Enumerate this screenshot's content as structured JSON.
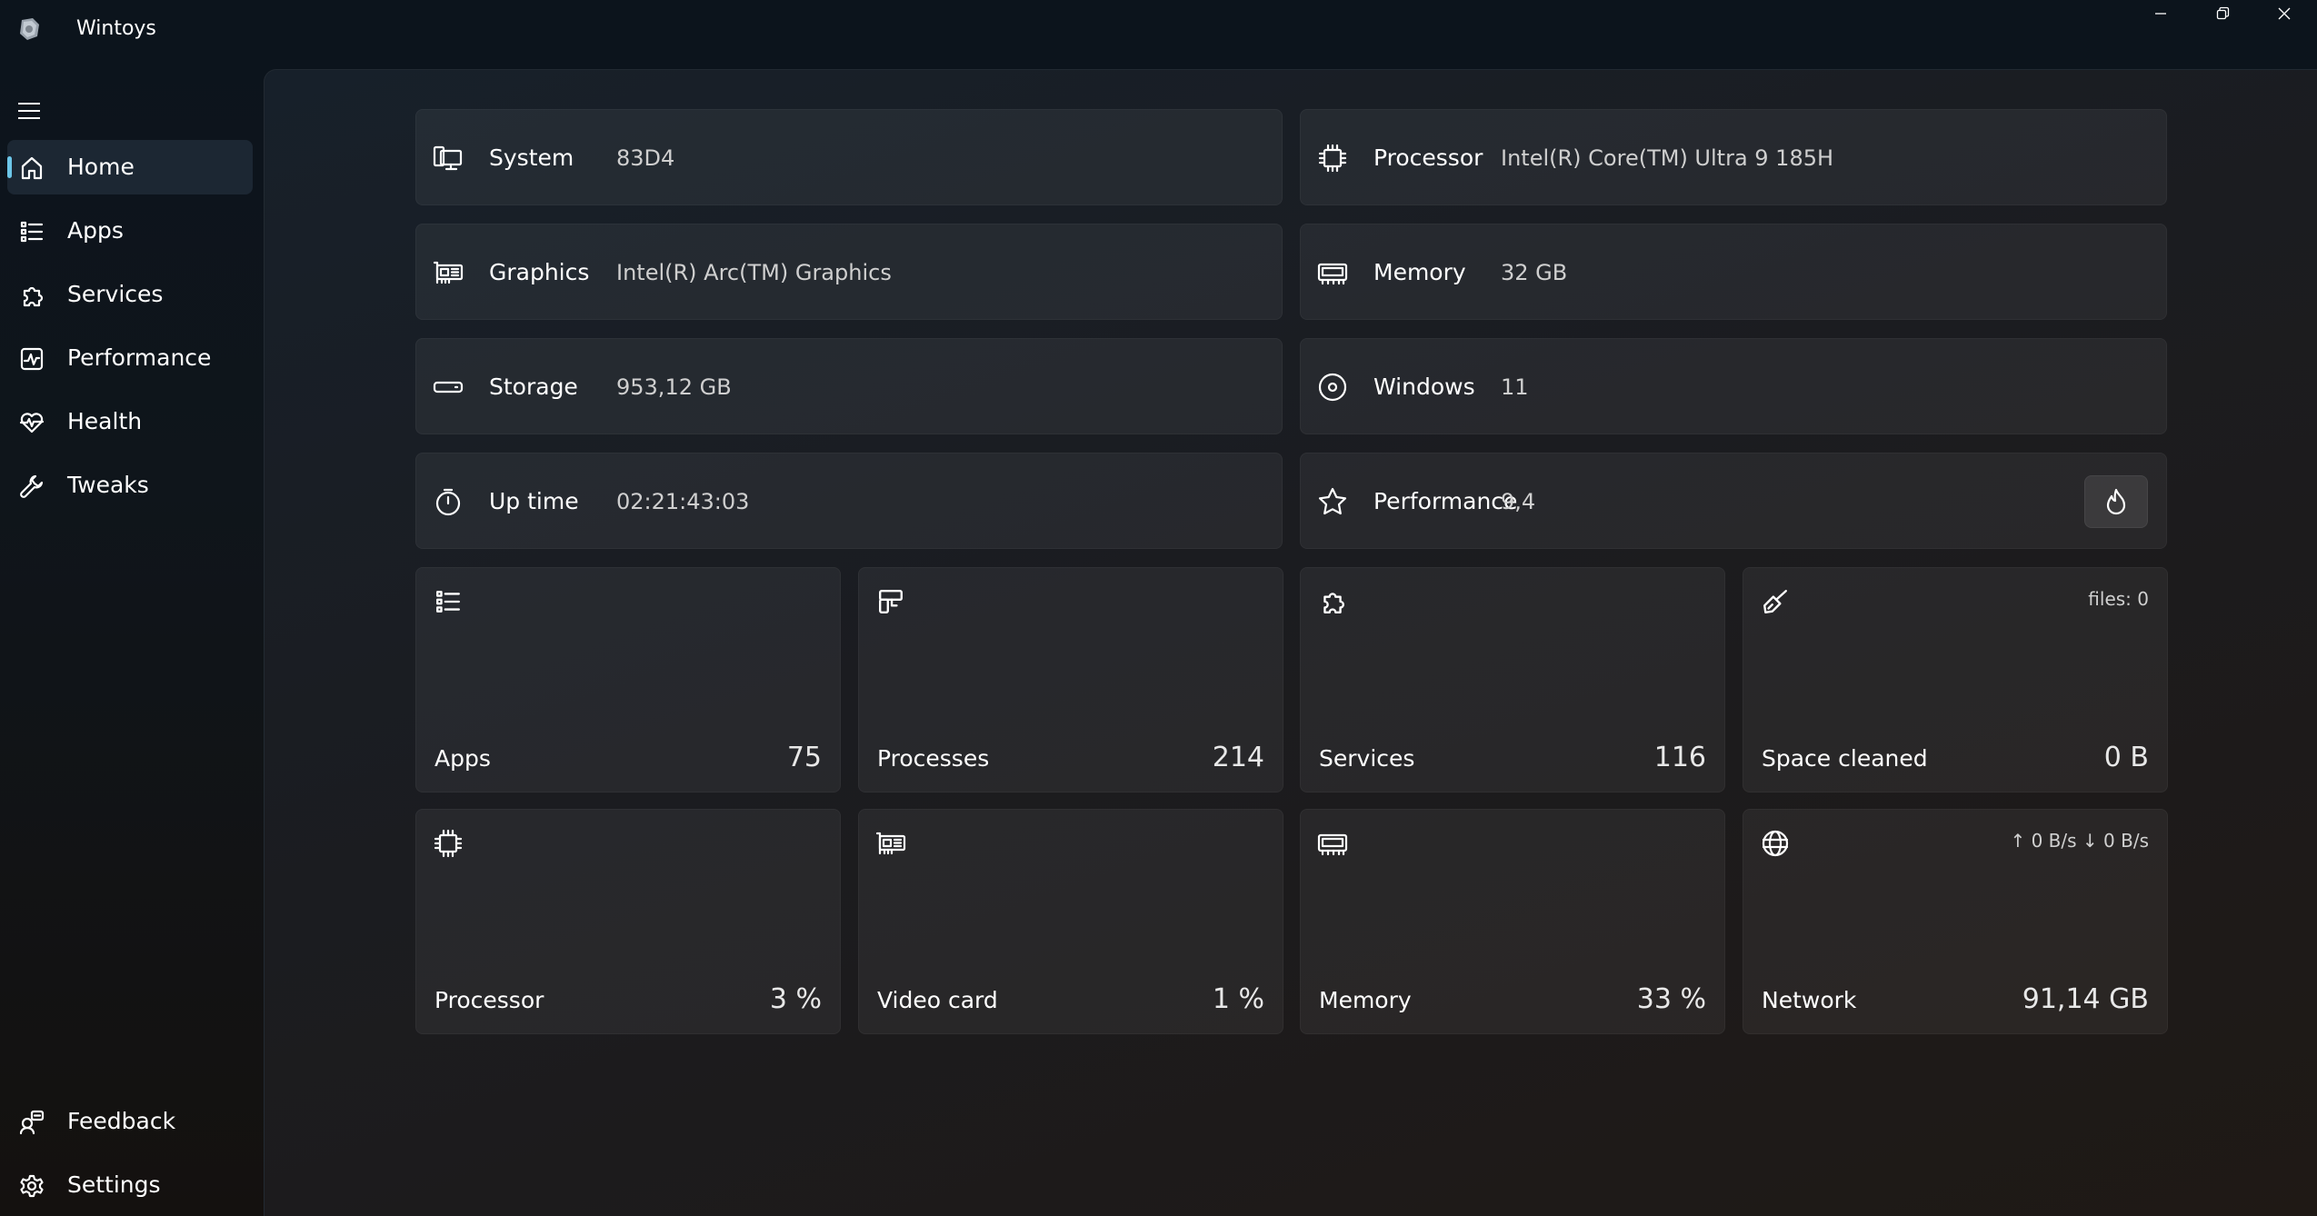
{
  "window": {
    "title": "Wintoys"
  },
  "sidebar": {
    "items": [
      {
        "label": "Home",
        "icon": "home-icon",
        "active": true
      },
      {
        "label": "Apps",
        "icon": "list-icon"
      },
      {
        "label": "Services",
        "icon": "puzzle-icon"
      },
      {
        "label": "Performance",
        "icon": "pulse-icon"
      },
      {
        "label": "Health",
        "icon": "heart-pulse-icon"
      },
      {
        "label": "Tweaks",
        "icon": "wrench-icon"
      }
    ],
    "footer": [
      {
        "label": "Feedback",
        "icon": "feedback-icon"
      },
      {
        "label": "Settings",
        "icon": "gear-icon"
      }
    ]
  },
  "info": {
    "system": {
      "label": "System",
      "value": "83D4",
      "icon": "computer-icon"
    },
    "processor": {
      "label": "Processor",
      "value": "Intel(R) Core(TM) Ultra 9 185H",
      "icon": "cpu-icon"
    },
    "graphics": {
      "label": "Graphics",
      "value": "Intel(R) Arc(TM) Graphics",
      "icon": "gpu-icon"
    },
    "memory": {
      "label": "Memory",
      "value": "32 GB",
      "icon": "memory-icon"
    },
    "storage": {
      "label": "Storage",
      "value": "953,12 GB",
      "icon": "drive-icon"
    },
    "windows": {
      "label": "Windows",
      "value": "11",
      "icon": "disc-icon"
    },
    "uptime": {
      "label": "Up time",
      "value": "02:21:43:03",
      "icon": "stopwatch-icon"
    },
    "performance": {
      "label": "Performance",
      "value": "9,4",
      "icon": "star-icon",
      "button_icon": "flame-icon"
    }
  },
  "tiles": {
    "apps": {
      "label": "Apps",
      "value": "75",
      "icon": "list-icon"
    },
    "processes": {
      "label": "Processes",
      "value": "214",
      "icon": "processes-icon"
    },
    "services": {
      "label": "Services",
      "value": "116",
      "icon": "puzzle-icon"
    },
    "space_cleaned": {
      "label": "Space cleaned",
      "value": "0 B",
      "meta": "files: 0",
      "icon": "broom-icon"
    },
    "processor": {
      "label": "Processor",
      "value": "3 %",
      "icon": "cpu-icon"
    },
    "video_card": {
      "label": "Video card",
      "value": "1 %",
      "icon": "gpu-icon"
    },
    "memory": {
      "label": "Memory",
      "value": "33 %",
      "icon": "memory-icon"
    },
    "network": {
      "label": "Network",
      "value": "91,14 GB",
      "meta": "↑ 0 B/s  ↓ 0 B/s",
      "icon": "globe-icon"
    }
  },
  "colors": {
    "accent": "#6cc6e8",
    "background": "#0d141a",
    "card": "#2a2a2c"
  }
}
